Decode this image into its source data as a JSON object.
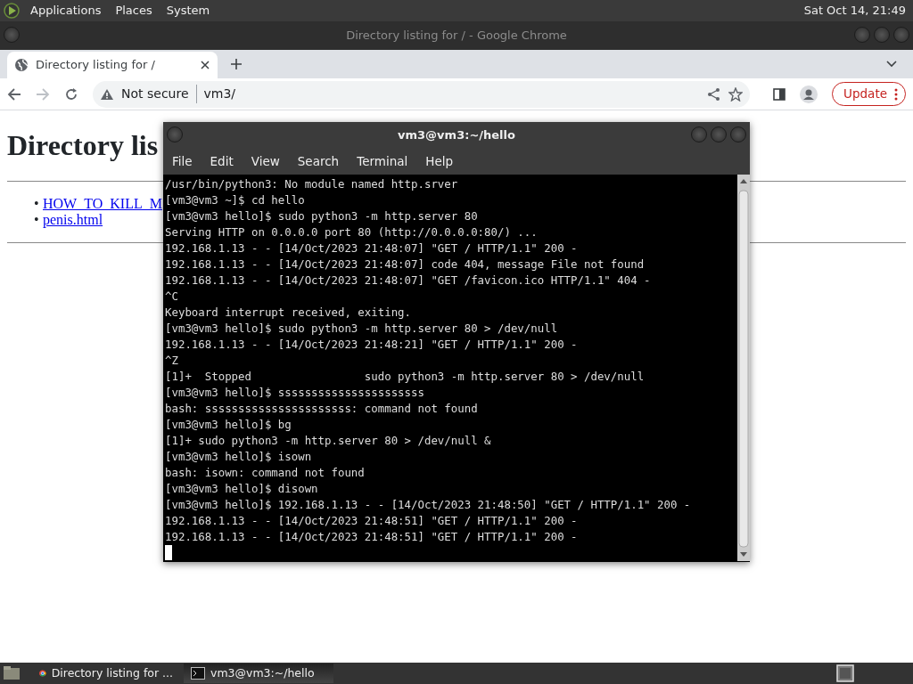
{
  "top_panel": {
    "menus": [
      "Applications",
      "Places",
      "System"
    ],
    "clock": "Sat Oct 14, 21:49"
  },
  "browser": {
    "window_title": "Directory listing for / - Google Chrome",
    "tabs": [
      {
        "label": "Directory listing for /",
        "selected": true
      }
    ],
    "forward_disabled": true,
    "address": {
      "security": "Not secure",
      "url": "vm3/"
    },
    "update_button": "Update",
    "page": {
      "heading": "Directory lis",
      "links": [
        {
          "marker": "•",
          "label": "HOW_TO_KILL_M"
        },
        {
          "marker": "•",
          "label": "penis.html"
        }
      ]
    }
  },
  "terminal": {
    "title": "vm3@vm3:~/hello",
    "menus": [
      "File",
      "Edit",
      "View",
      "Search",
      "Terminal",
      "Help"
    ],
    "lines": [
      "/usr/bin/python3: No module named http.srver",
      "[vm3@vm3 ~]$ cd hello",
      "[vm3@vm3 hello]$ sudo python3 -m http.server 80",
      "Serving HTTP on 0.0.0.0 port 80 (http://0.0.0.0:80/) ...",
      "192.168.1.13 - - [14/Oct/2023 21:48:07] \"GET / HTTP/1.1\" 200 -",
      "192.168.1.13 - - [14/Oct/2023 21:48:07] code 404, message File not found",
      "192.168.1.13 - - [14/Oct/2023 21:48:07] \"GET /favicon.ico HTTP/1.1\" 404 -",
      "^C",
      "Keyboard interrupt received, exiting.",
      "[vm3@vm3 hello]$ sudo python3 -m http.server 80 > /dev/null",
      "192.168.1.13 - - [14/Oct/2023 21:48:21] \"GET / HTTP/1.1\" 200 -",
      "^Z",
      "[1]+  Stopped                 sudo python3 -m http.server 80 > /dev/null",
      "[vm3@vm3 hello]$ ssssssssssssssssssssss",
      "bash: ssssssssssssssssssssss: command not found",
      "[vm3@vm3 hello]$ bg",
      "[1]+ sudo python3 -m http.server 80 > /dev/null &",
      "[vm3@vm3 hello]$ isown",
      "bash: isown: command not found",
      "[vm3@vm3 hello]$ disown",
      "[vm3@vm3 hello]$ 192.168.1.13 - - [14/Oct/2023 21:48:50] \"GET / HTTP/1.1\" 200 -",
      "192.168.1.13 - - [14/Oct/2023 21:48:51] \"GET / HTTP/1.1\" 200 -",
      "192.168.1.13 - - [14/Oct/2023 21:48:51] \"GET / HTTP/1.1\" 200 -"
    ]
  },
  "taskbar": {
    "tasks": [
      {
        "kind": "browser",
        "label": "Directory listing for ...",
        "selected": false
      },
      {
        "kind": "terminal",
        "label": "vm3@vm3:~/hello",
        "selected": true
      }
    ]
  }
}
